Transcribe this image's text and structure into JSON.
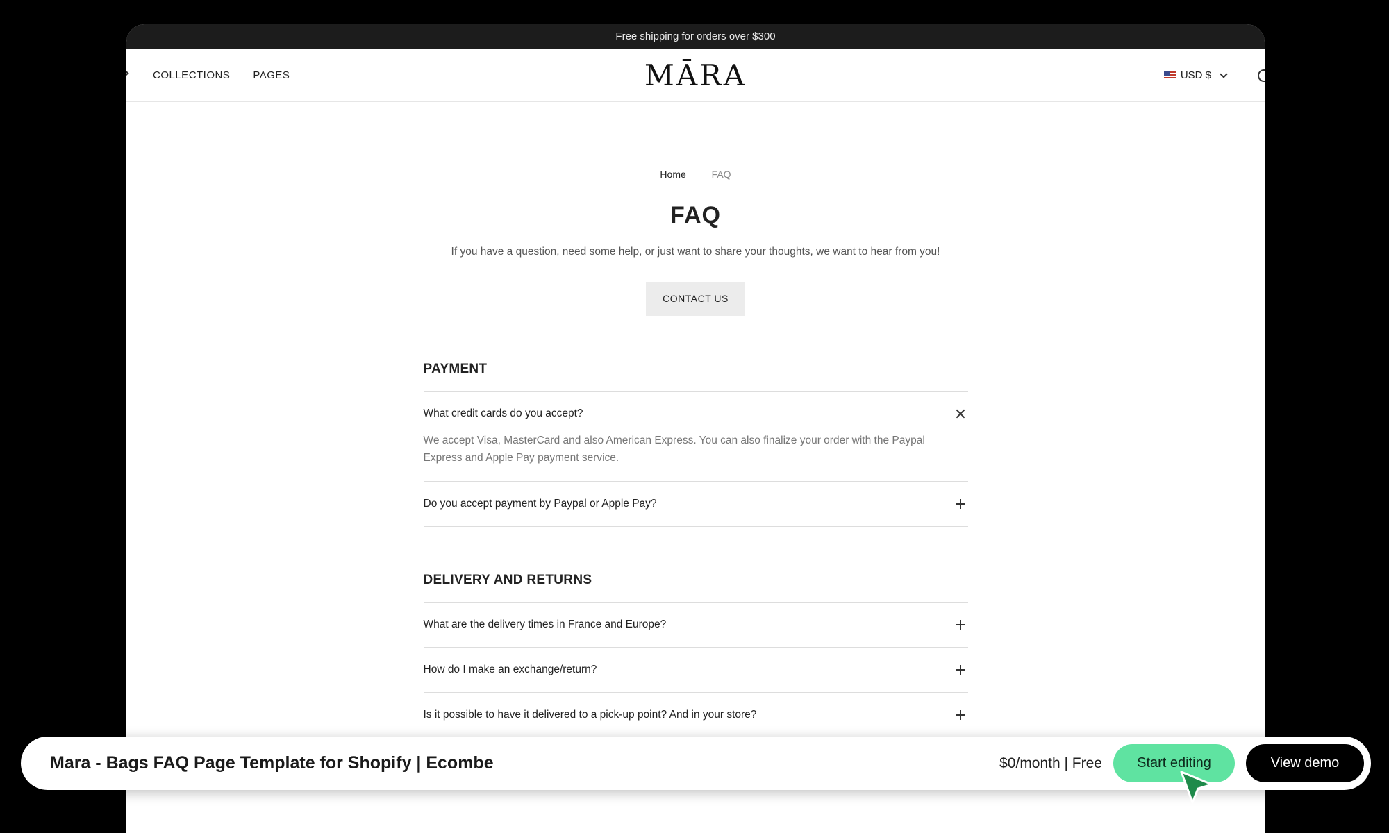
{
  "announcement": {
    "text": "Free shipping for orders over $300"
  },
  "nav": {
    "items": [
      "COLLECTIONS",
      "PAGES"
    ]
  },
  "logo": {
    "text": "MĀRA"
  },
  "currency": {
    "label": "USD $",
    "flag_icon": "us-flag-icon"
  },
  "breadcrumb": {
    "home": "Home",
    "current": "FAQ"
  },
  "page": {
    "title": "FAQ",
    "subtitle": "If you have a question, need some help, or just want to share your thoughts, we want to hear from you!",
    "contact_button": "CONTACT US"
  },
  "sections": [
    {
      "title": "PAYMENT",
      "items": [
        {
          "question": "What credit cards do you accept?",
          "expanded": true,
          "answer": "We accept Visa, MasterCard and also American Express. You can also finalize your order with the Paypal Express and Apple Pay payment service."
        },
        {
          "question": "Do you accept payment by Paypal or Apple Pay?",
          "expanded": false
        }
      ]
    },
    {
      "title": "DELIVERY AND RETURNS",
      "items": [
        {
          "question": "What are the delivery times in France and Europe?",
          "expanded": false
        },
        {
          "question": "How do I make an exchange/return?",
          "expanded": false
        },
        {
          "question": "Is it possible to have it delivered to a pick-up point? And in your store?",
          "expanded": false
        }
      ]
    }
  ],
  "bottom_bar": {
    "title": "Mara - Bags FAQ Page Template for Shopify | Ecombe",
    "price": "$0/month | Free",
    "start_button": "Start editing",
    "demo_button": "View demo"
  },
  "colors": {
    "accent_green": "#5fe3a1",
    "cursor_green": "#1e8a4a",
    "announcement_bg": "#1c1c1c"
  }
}
